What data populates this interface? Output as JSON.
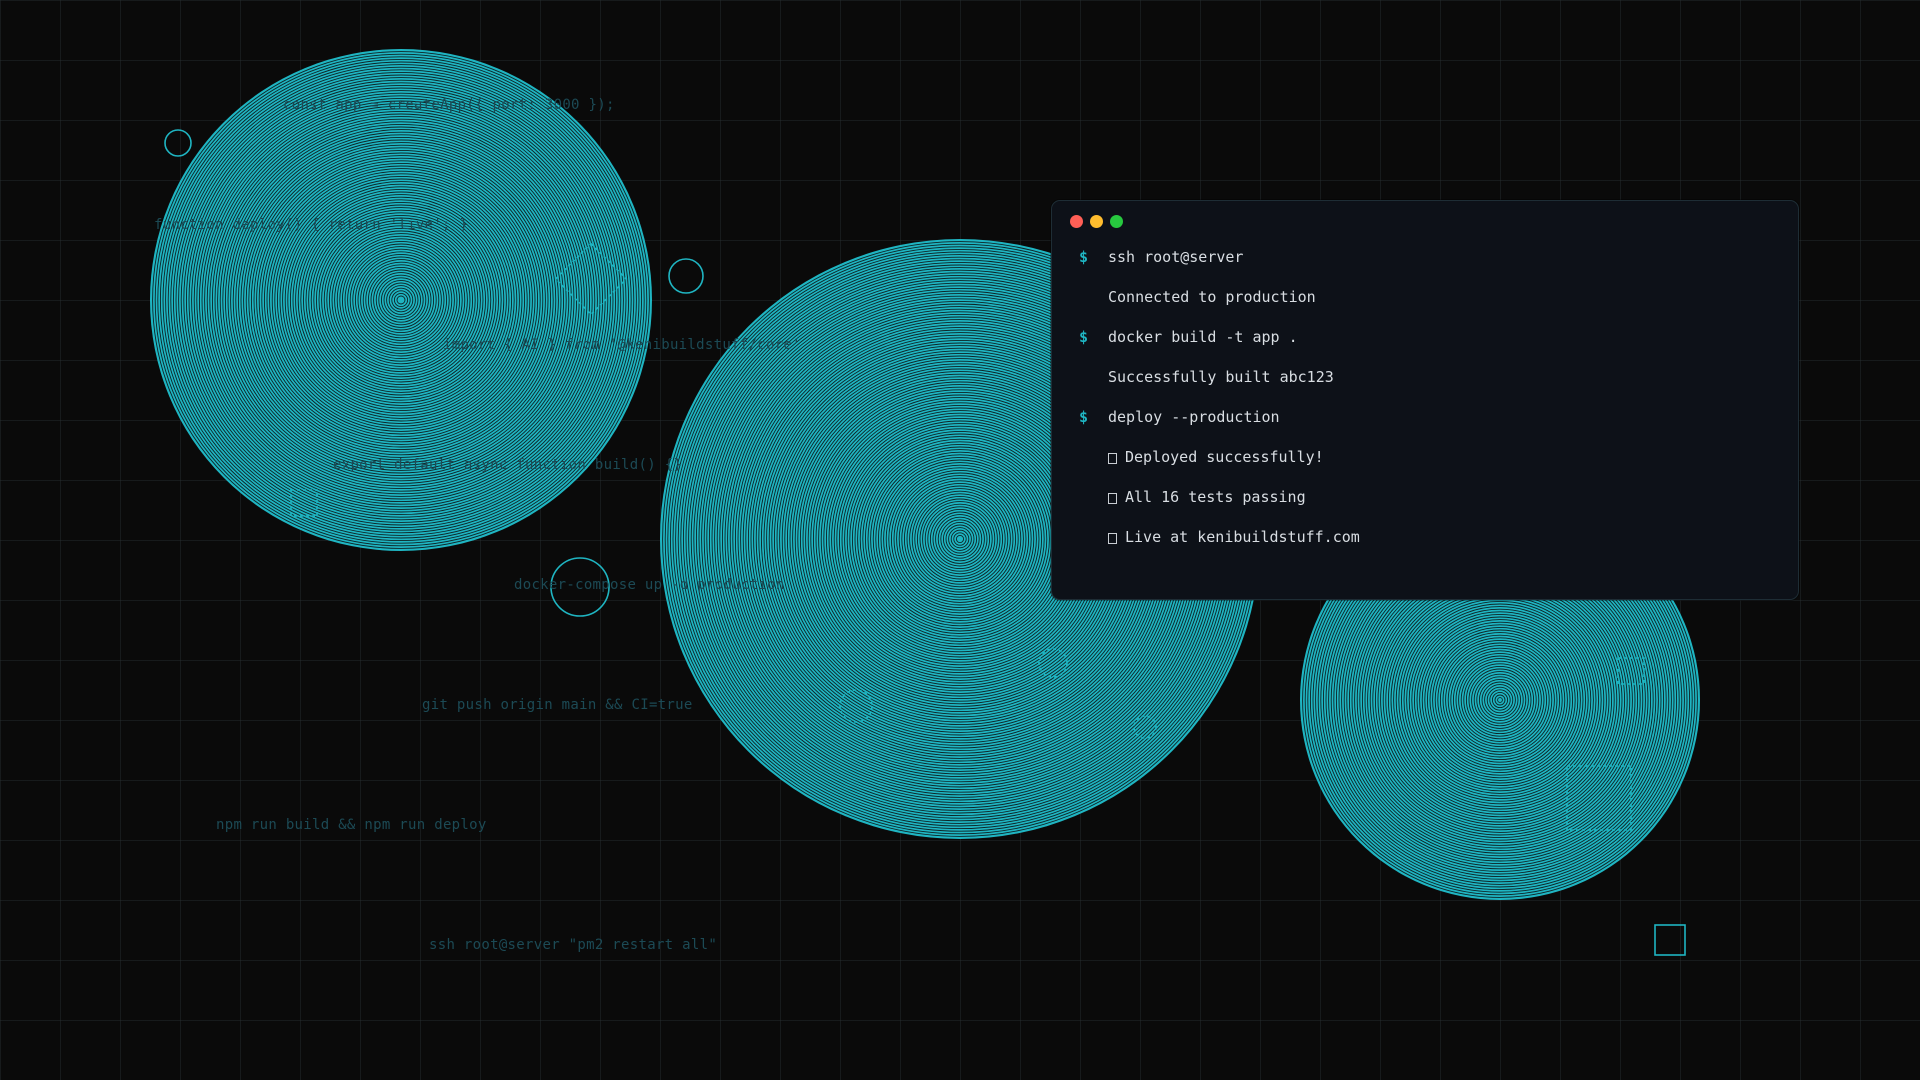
{
  "background_code": [
    "const app = createApp({ port: 3000 });",
    "function deploy() { return 'live'; }",
    "import { AI } from '@kenibuildstuff/core'",
    "export default async function build() {}",
    "docker-compose up -d production",
    "git push origin main && CI=true",
    "npm run build && npm run deploy",
    "ssh root@server \"pm2 restart all\""
  ],
  "terminal": {
    "lines": [
      {
        "kind": "command",
        "prompt": "$",
        "text": "ssh root@server"
      },
      {
        "kind": "output",
        "text": "Connected to production"
      },
      {
        "kind": "command",
        "prompt": "$",
        "text": "docker build -t app ."
      },
      {
        "kind": "output",
        "text": "Successfully built abc123"
      },
      {
        "kind": "command",
        "prompt": "$",
        "text": "deploy --production"
      },
      {
        "kind": "status",
        "icon": "check-icon",
        "text": "Deployed successfully!"
      },
      {
        "kind": "status",
        "icon": "check-icon",
        "text": "All 16 tests passing"
      },
      {
        "kind": "status",
        "icon": "check-icon",
        "text": "Live at kenibuildstuff.com"
      }
    ]
  },
  "colors": {
    "background": "#0a0a0a",
    "accent": "#1fb5c2",
    "terminal_bg": "#0d1118",
    "terminal_text": "#d8dde2",
    "code_dim": "#1c4a55",
    "dot_red": "#ff5f56",
    "dot_yellow": "#ffbd2e",
    "dot_green": "#27c93f"
  }
}
